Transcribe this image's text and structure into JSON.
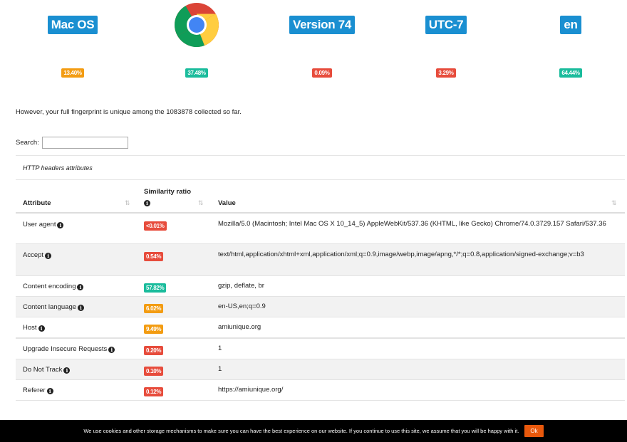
{
  "summary": {
    "os": {
      "label": "Mac OS",
      "pct": "13.40%",
      "color": "orange"
    },
    "browser": {
      "icon": "chrome-icon",
      "pct": "37.48%",
      "color": "green"
    },
    "version": {
      "label": "Version 74",
      "pct": "0.09%",
      "color": "red"
    },
    "timezone": {
      "label": "UTC-7",
      "pct": "3.29%",
      "color": "red"
    },
    "language": {
      "label": "en",
      "pct": "64.44%",
      "color": "green"
    }
  },
  "fingerprint_text": "However, your full fingerprint is unique among the 1083878 collected so far.",
  "search": {
    "label": "Search:",
    "value": ""
  },
  "section_title": "HTTP headers attributes",
  "table": {
    "headers": {
      "attribute": "Attribute",
      "similarity": "Similarity ratio",
      "value": "Value"
    },
    "rows": [
      {
        "attribute": "User agent",
        "pct": "<0.01%",
        "color": "red",
        "value": "Mozilla/5.0 (Macintosh; Intel Mac OS X 10_14_5) AppleWebKit/537.36 (KHTML, like Gecko) Chrome/74.0.3729.157 Safari/537.36"
      },
      {
        "attribute": "Accept",
        "pct": "0.54%",
        "color": "red",
        "value": "text/html,application/xhtml+xml,application/xml;q=0.9,image/webp,image/apng,*/*;q=0.8,application/signed-exchange;v=b3"
      },
      {
        "attribute": "Content encoding",
        "pct": "57.82%",
        "color": "green",
        "value": "gzip, deflate, br"
      },
      {
        "attribute": "Content language",
        "pct": "6.02%",
        "color": "orange",
        "value": "en-US,en;q=0.9"
      },
      {
        "attribute": "Host",
        "pct": "9.49%",
        "color": "orange",
        "value": "amiunique.org"
      },
      {
        "attribute": "Upgrade Insecure Requests",
        "pct": "0.20%",
        "color": "red",
        "value": "1"
      },
      {
        "attribute": "Do Not Track",
        "pct": "0.10%",
        "color": "red",
        "value": "1"
      },
      {
        "attribute": "Referer",
        "pct": "0.12%",
        "color": "red",
        "value": "https://amiunique.org/"
      }
    ]
  },
  "cookie_bar": {
    "text": "We use cookies and other storage mechanisms to make sure you can have the best experience on our website. If you continue to use this site, we assume that you will be happy with it.",
    "ok_label": "Ok"
  },
  "colors": {
    "orange": "#f39c12",
    "green": "#1abc9c",
    "red": "#e74c3c",
    "badge_blue": "#1a8fd1",
    "ok_button": "#e8580c"
  }
}
